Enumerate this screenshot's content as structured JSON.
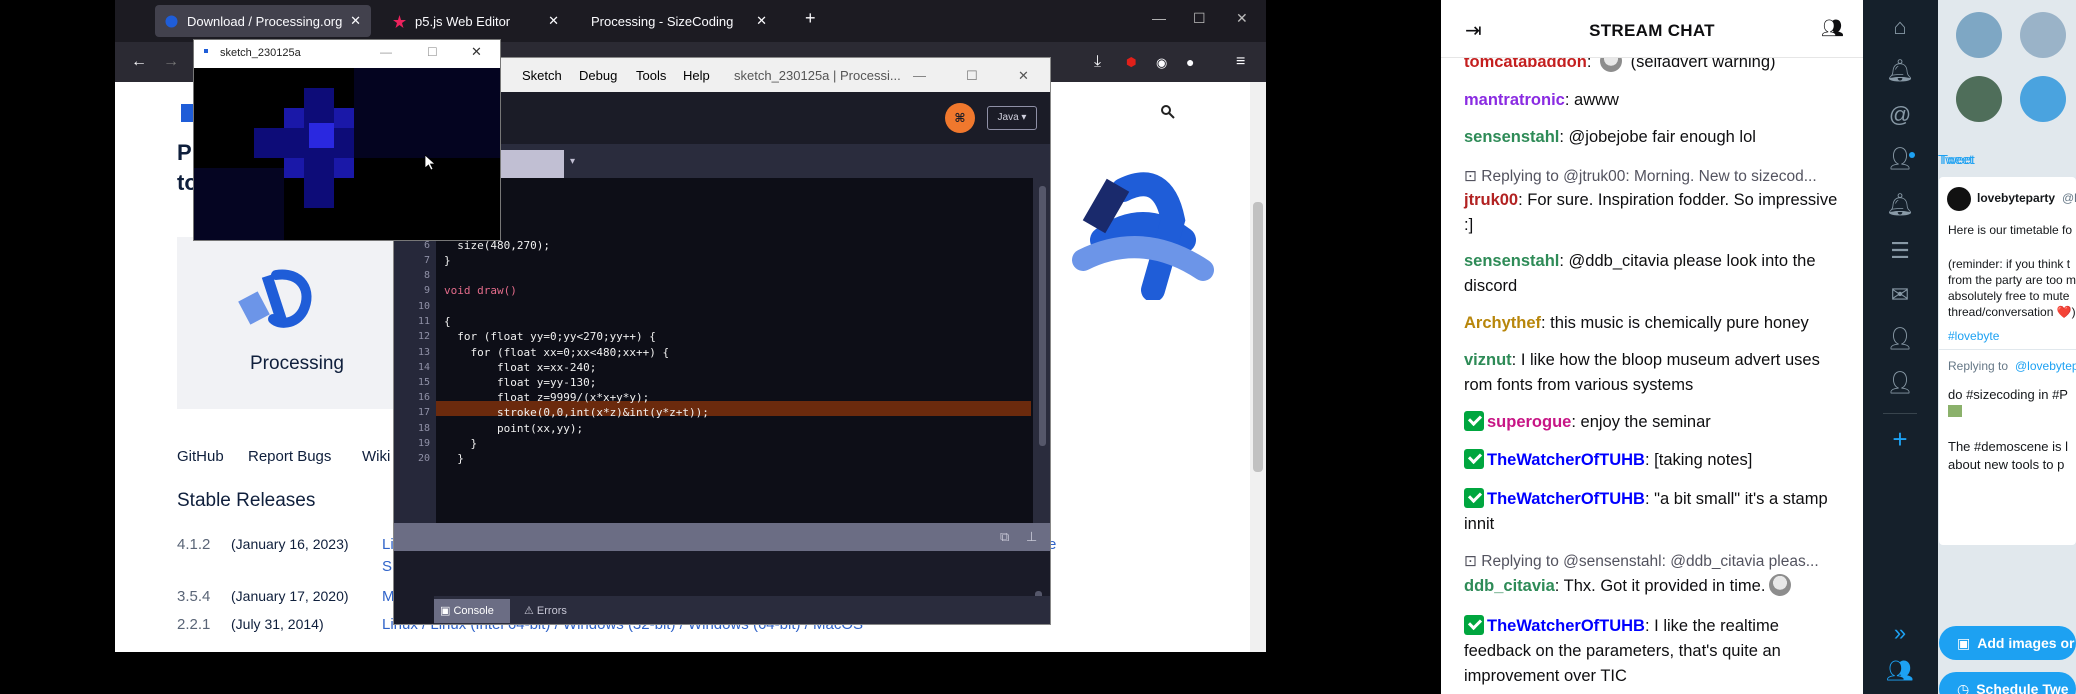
{
  "browser": {
    "tabs": [
      {
        "label": "Download / Processing.org",
        "active": true
      },
      {
        "label": "p5.js Web Editor",
        "active": false
      },
      {
        "label": "Processing - SizeCoding",
        "active": false
      }
    ],
    "new_tab": "+",
    "window_controls": {
      "minimize": "—",
      "maximize": "☐",
      "close": "✕"
    }
  },
  "page": {
    "heading_partial": [
      "Pr",
      "to"
    ],
    "logo_label": "Processing",
    "links": [
      "GitHub",
      "Report Bugs",
      "Wiki"
    ],
    "stable_releases_title": "Stable Releases",
    "releases": [
      {
        "version": "4.1.2",
        "date": "(January 16, 2023)",
        "links": "Linu",
        "links2": "Silic",
        "tail": "e"
      },
      {
        "version": "3.5.4",
        "date": "(January 17, 2020)",
        "links": "Mac"
      },
      {
        "version": "2.2.1",
        "date": "(July 31, 2014)",
        "links": "Linux  /  Linux (Intel 64-bit)  /  Windows (32-bit)  /  Windows (64-bit)  /  MacOS"
      }
    ]
  },
  "ide": {
    "menus": [
      "t",
      "Sketch",
      "Debug",
      "Tools",
      "Help"
    ],
    "title": "sketch_230125a | Processi...",
    "mode": "Java ▾",
    "tab_name": "30125a",
    "tab_arrow": "▾",
    "code_lines": [
      {
        "n": "",
        "text": "up()"
      },
      {
        "n": "6",
        "text": "  size(480,270);"
      },
      {
        "n": "7",
        "text": "}"
      },
      {
        "n": "8",
        "text": ""
      },
      {
        "n": "9",
        "text": "void draw()"
      },
      {
        "n": "10",
        "text": ""
      },
      {
        "n": "11",
        "text": "{"
      },
      {
        "n": "12",
        "text": "  for (float yy=0;yy<270;yy++) {"
      },
      {
        "n": "13",
        "text": "    for (float xx=0;xx<480;xx++) {"
      },
      {
        "n": "14",
        "text": "        float x=xx-240;"
      },
      {
        "n": "15",
        "text": "        float y=yy-130;"
      },
      {
        "n": "16",
        "text": "        float z=9999/(x*x+y*y);"
      },
      {
        "n": "17",
        "text": "        stroke(0,0,int(x*z)&int(y*z+t));"
      },
      {
        "n": "18",
        "text": "        point(xx,yy);"
      },
      {
        "n": "19",
        "text": "    }"
      },
      {
        "n": "20",
        "text": "  }"
      }
    ],
    "console_tab": "Console",
    "errors_tab": "Errors"
  },
  "sketch_window": {
    "title": "sketch_230125a"
  },
  "chat": {
    "title": "STREAM CHAT",
    "messages": [
      {
        "type": "msg",
        "user": "tomcatabaddon",
        "color": "#c41f1f",
        "text": ": ",
        "emote": true,
        "text2": " (selfadvert warning)"
      },
      {
        "type": "msg",
        "user": "mantratronic",
        "color": "#8a2be2",
        "text": ": awww"
      },
      {
        "type": "msg",
        "user": "sensenstahl",
        "color": "#2e8b57",
        "text": ": @jobejobe fair enough lol"
      },
      {
        "type": "reply",
        "text": "Replying to @jtruk00: Morning. New to sizecod..."
      },
      {
        "type": "msg",
        "user": "jtruk00",
        "color": "#b22222",
        "text": ": For sure. Inspiration fodder. So impressive :]"
      },
      {
        "type": "msg",
        "user": "sensenstahl",
        "color": "#2e8b57",
        "text": ": @ddb_citavia please look into the discord"
      },
      {
        "type": "msg",
        "user": "Archythef",
        "color": "#b8860b",
        "text": ": this music is chemically pure honey"
      },
      {
        "type": "msg",
        "user": "viznut",
        "color": "#2e8b57",
        "text": ": I like how the bloop museum advert uses rom fonts from various systems"
      },
      {
        "type": "msg",
        "user": "superogue",
        "color": "#c71585",
        "text": ": enjoy the seminar",
        "badge": true
      },
      {
        "type": "msg",
        "user": "TheWatcherOfTUHB",
        "color": "#0000ff",
        "text": ": [taking notes]",
        "badge": true
      },
      {
        "type": "msg",
        "user": "TheWatcherOfTUHB",
        "color": "#0000ff",
        "text": ": \"a bit small\" it's a stamp innit",
        "badge": true
      },
      {
        "type": "reply",
        "text": "Replying to @sensenstahl: @ddb_citavia pleas..."
      },
      {
        "type": "msg",
        "user": "ddb_citavia",
        "color": "#2e8b57",
        "text": ": Thx. Got it provided in time.",
        "emote": true
      },
      {
        "type": "msg",
        "user": "TheWatcherOfTUHB",
        "color": "#0000ff",
        "text": ": I like the realtime feedback on the parameters, that's quite an improvement over TIC",
        "badge": true
      }
    ]
  },
  "tweetdeck": {
    "tweet_label": "Tweet",
    "author": "lovebyteparty",
    "author_handle": "@lo",
    "lines": [
      "Here is our timetable fo",
      "",
      "(reminder: if you think t",
      "from the party are too m",
      "absolutely free to mute",
      "thread/conversation ❤️)"
    ],
    "hashtag": "#lovebyte",
    "replying": "Replying to",
    "replying_handle": "@lovebytep",
    "body2": [
      "do #sizecoding in #P",
      "",
      "The #demoscene is l",
      "about new tools to p"
    ],
    "add_images": "Add images or",
    "schedule": "Schedule Twe"
  },
  "colors": {
    "accent_blue": "#1da1f2",
    "processing_orange": "#f0782d",
    "browser_dark": "#1c1b22"
  }
}
